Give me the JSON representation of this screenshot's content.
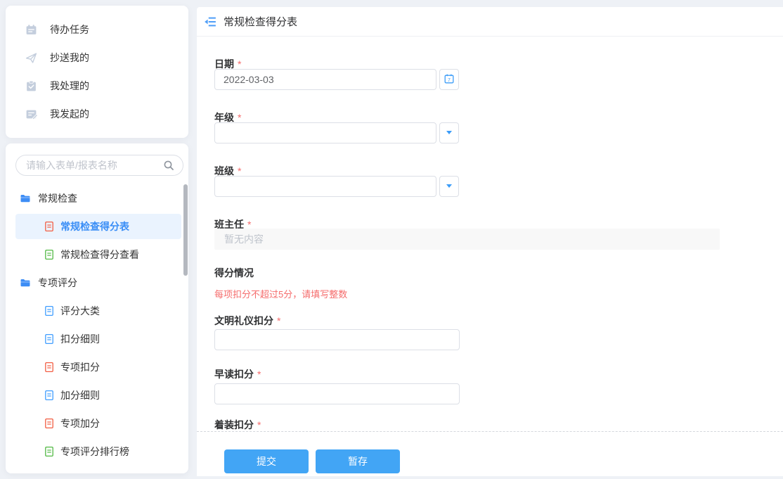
{
  "colors": {
    "primary": "#409eff",
    "button_blue": "#42a5f5",
    "danger": "#f56c6c",
    "selected_row_bg": "#eaf3fe",
    "page_bg": "#eef1f6",
    "doc_icon_orange": "#f25e43",
    "doc_icon_green": "#52b944",
    "doc_icon_blue": "#409eff"
  },
  "quick_menu": {
    "items": [
      {
        "label": "待办任务",
        "icon": "calendar-task-icon"
      },
      {
        "label": "抄送我的",
        "icon": "paper-plane-icon"
      },
      {
        "label": "我处理的",
        "icon": "clipboard-check-icon"
      },
      {
        "label": "我发起的",
        "icon": "document-edit-icon"
      }
    ]
  },
  "sidebar": {
    "search_placeholder": "请输入表单/报表名称"
  },
  "tree": {
    "groups": [
      {
        "label": "常规检查",
        "children": [
          {
            "label": "常规检查得分表",
            "selected": true,
            "icon_color": "orange"
          },
          {
            "label": "常规检查得分查看",
            "selected": false,
            "icon_color": "green"
          }
        ]
      },
      {
        "label": "专项评分",
        "children": [
          {
            "label": "评分大类",
            "selected": false,
            "icon_color": "blue"
          },
          {
            "label": "扣分细则",
            "selected": false,
            "icon_color": "blue"
          },
          {
            "label": "专项扣分",
            "selected": false,
            "icon_color": "orange"
          },
          {
            "label": "加分细则",
            "selected": false,
            "icon_color": "blue"
          },
          {
            "label": "专项加分",
            "selected": false,
            "icon_color": "orange"
          },
          {
            "label": "专项评分排行榜",
            "selected": false,
            "icon_color": "green"
          }
        ]
      }
    ]
  },
  "main": {
    "title": "常规检查得分表",
    "required_marker": "*",
    "form": {
      "date": {
        "label": "日期",
        "value": "2022-03-03"
      },
      "grade": {
        "label": "年级",
        "value": ""
      },
      "clazz": {
        "label": "班级",
        "value": ""
      },
      "teacher": {
        "label": "班主任",
        "placeholder": "暂无内容"
      },
      "score_section": {
        "label": "得分情况",
        "hint": "每项扣分不超过5分，请填写整数"
      },
      "civility": {
        "label": "文明礼仪扣分",
        "value": ""
      },
      "morning_reading": {
        "label": "早读扣分",
        "value": ""
      },
      "dress": {
        "label": "着装扣分"
      }
    },
    "buttons": {
      "submit": "提交",
      "draft": "暂存"
    }
  }
}
